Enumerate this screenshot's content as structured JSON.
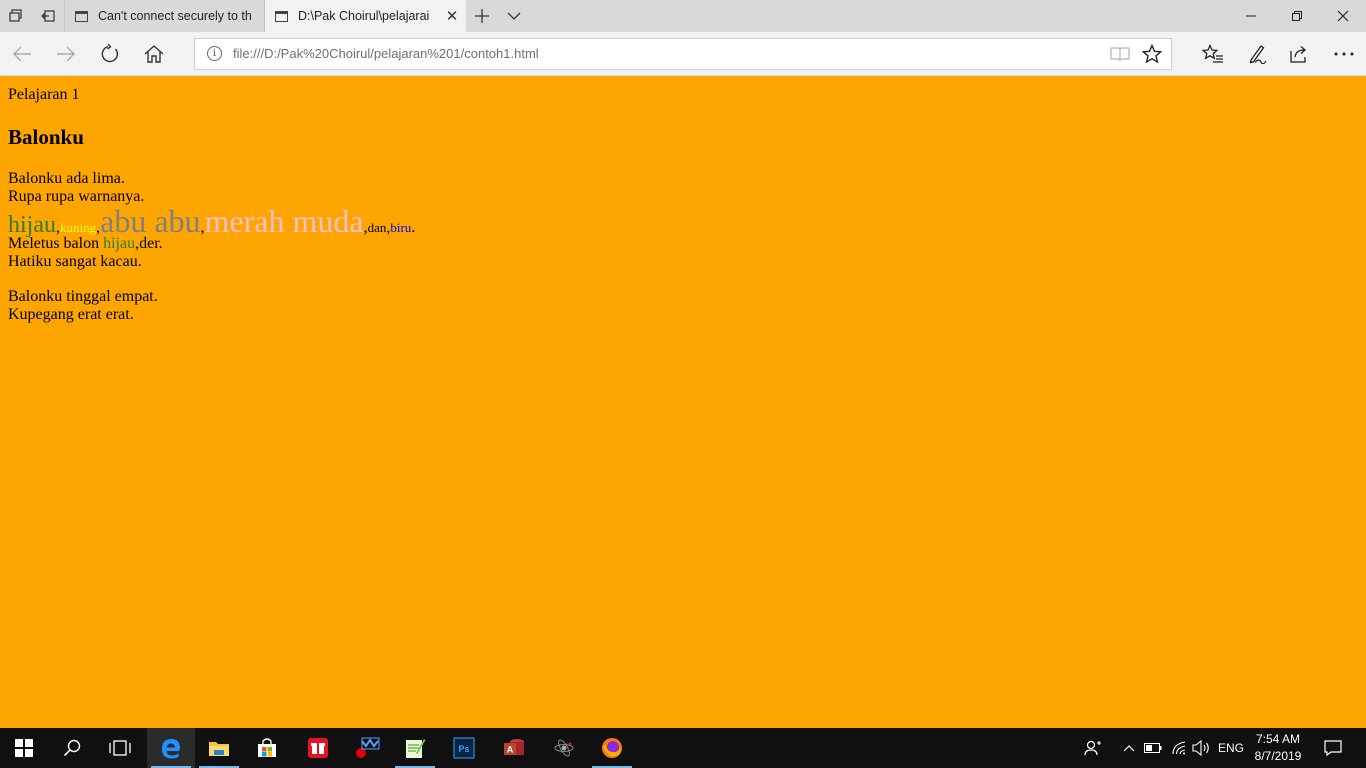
{
  "browser": {
    "tabs": [
      {
        "title": "Can't connect securely to th"
      },
      {
        "title": "D:\\Pak Choirul\\pelajarai"
      }
    ],
    "address_url": "file:///D:/Pak%20Choirul/pelajaran%201/contoh1.html"
  },
  "page": {
    "intro": "Pelajaran 1",
    "heading": "Balonku",
    "line1": "Balonku ada lima.",
    "line2": "Rupa rupa warnanya.",
    "colors": [
      {
        "text": "hijau",
        "color": "#2e7d1e"
      },
      {
        "text": "kuning",
        "color": "#ffff00"
      },
      {
        "text": "abu abu",
        "color": "#808080"
      },
      {
        "text": "merah muda",
        "color": "#ffc0cb"
      },
      {
        "text": "dan",
        "color": "#000000"
      },
      {
        "text": "biru",
        "color": "#0000ff"
      }
    ],
    "separator": ",",
    "end_period": ".",
    "meletus_prefix": "Meletus balon ",
    "meletus_color_word": "hijau",
    "meletus_suffix": ",der.",
    "line4": "Hatiku sangat kacau.",
    "line5": "Balonku tinggal empat.",
    "line6": "Kupegang erat erat."
  },
  "taskbar": {
    "lang": "ENG",
    "time": "7:54 AM",
    "date": "8/7/2019"
  }
}
